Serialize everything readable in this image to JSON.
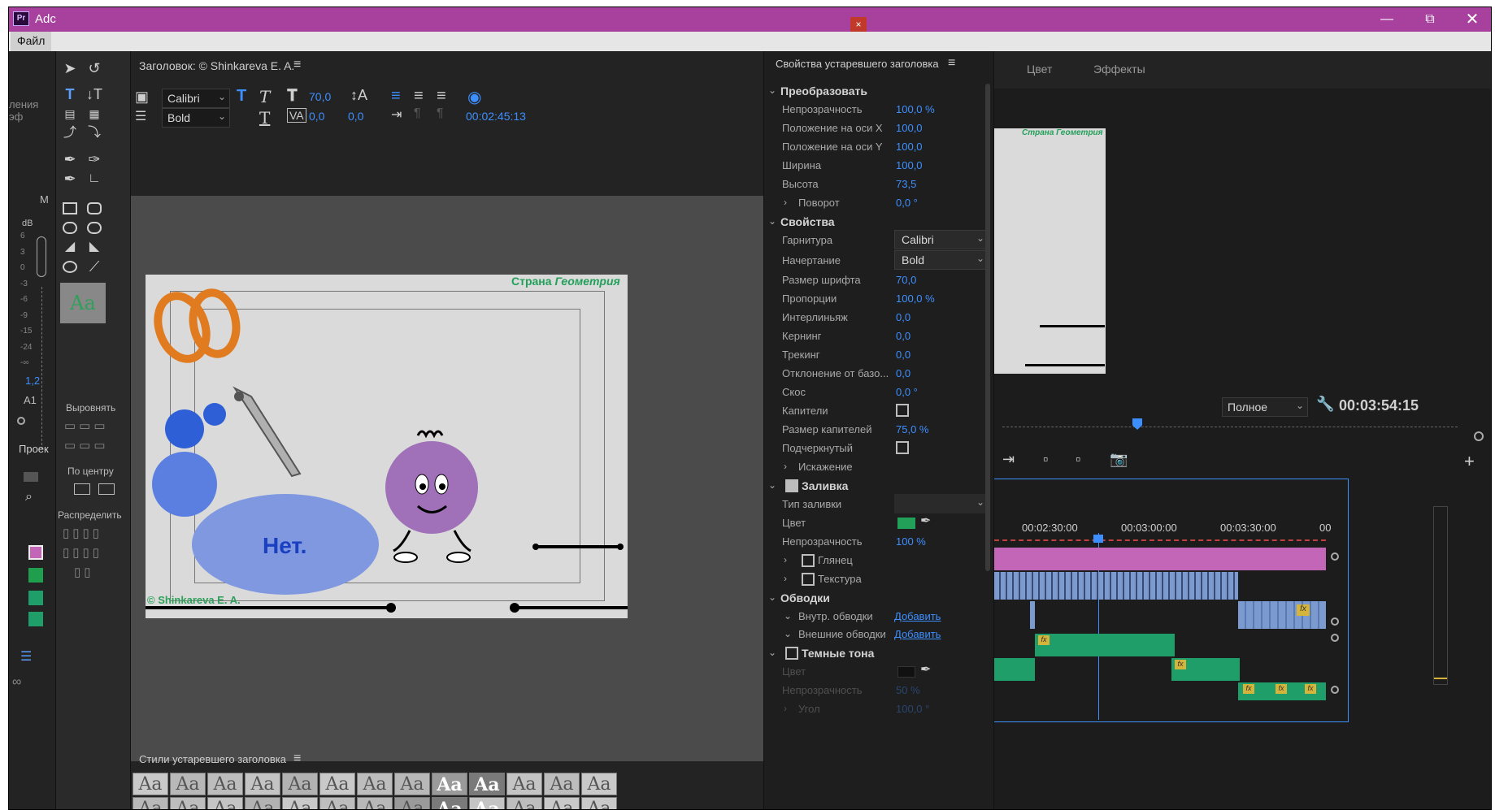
{
  "app": {
    "title": "Adc",
    "icon": "Pr"
  },
  "menu": {
    "file": "Файл"
  },
  "left": {
    "effects_fragment": "ления эф",
    "letter_m": "М",
    "db": "dB",
    "meter_ticks": [
      "6",
      "3",
      "0",
      "-3",
      "-6",
      "-9",
      "-15",
      "-24",
      "-∞"
    ],
    "value": "1,2",
    "a1": "A1",
    "project": "Проек"
  },
  "tools": {
    "align_label": "Выровнять",
    "center_label": "По центру",
    "distribute_label": "Распределить",
    "sample_text": "Aa"
  },
  "editor": {
    "header": "Заголовок: © Shinkareva E. A.",
    "font_family": "Calibri",
    "font_style": "Bold",
    "font_size": "70,0",
    "kerning": "0,0",
    "leading": "0,0",
    "timecode": "00:02:45:13",
    "frame": {
      "top_title_part1": "Страна ",
      "top_title_part2": "Геометрия",
      "bubble_text": "Нет.",
      "copyright": "© Shinkareva E. A."
    }
  },
  "styles": {
    "title": "Стили устаревшего заголовка",
    "sample": "Aa"
  },
  "props": {
    "title": "Свойства устаревшего заголовка",
    "transform": "Преобразовать",
    "opacity_label": "Непрозрачность",
    "opacity": "100,0 %",
    "pos_x_label": "Положение на оси X",
    "pos_x": "100,0",
    "pos_y_label": "Положение на оси Y",
    "pos_y": "100,0",
    "width_label": "Ширина",
    "width": "100,0",
    "height_label": "Высота",
    "height": "73,5",
    "rotation_label": "Поворот",
    "rotation": "0,0 °",
    "properties": "Свойства",
    "font_label": "Гарнитура",
    "font": "Calibri",
    "style_label": "Начертание",
    "style": "Bold",
    "size_label": "Размер шрифта",
    "size": "70,0",
    "aspect_label": "Пропорции",
    "aspect": "100,0 %",
    "leading_label": "Интерлиньяж",
    "leading": "0,0",
    "kerning_label": "Кернинг",
    "kerning": "0,0",
    "tracking_label": "Трекинг",
    "tracking": "0,0",
    "baseline_label": "Отклонение от базо...",
    "baseline": "0,0",
    "slant_label": "Скос",
    "slant": "0,0 °",
    "caps_label": "Капители",
    "caps_size_label": "Размер капителей",
    "caps_size": "75,0 %",
    "underline_label": "Подчеркнутый",
    "distort_label": "Искажение",
    "fill": "Заливка",
    "fill_type_label": "Тип заливки",
    "color_label": "Цвет",
    "fill_opacity_label": "Непрозрачность",
    "fill_opacity": "100 %",
    "sheen_label": "Глянец",
    "texture_label": "Текстура",
    "strokes": "Обводки",
    "inner_label": "Внутр. обводки",
    "inner_add": "Добавить",
    "outer_label": "Внешние обводки",
    "outer_add": "Добавить",
    "shadow": "Темные тона",
    "shadow_color_label": "Цвет",
    "shadow_opacity_label": "Непрозрачность",
    "shadow_opacity": "50 %",
    "angle_label": "Угол",
    "angle": "100,0 °"
  },
  "monitor": {
    "tab_color": "Цвет",
    "tab_effects": "Эффекты",
    "preview_title": "Страна Геометрия",
    "quality": "Полное",
    "timecode": "00:03:54:15"
  },
  "timeline": {
    "times": [
      "00:02:30:00",
      "00:03:00:00",
      "00:03:30:00",
      "00"
    ],
    "fx": "fx"
  },
  "colors": {
    "accent": "#a8409e",
    "blue": "#3d8fff",
    "fill_green": "#22a05a"
  }
}
